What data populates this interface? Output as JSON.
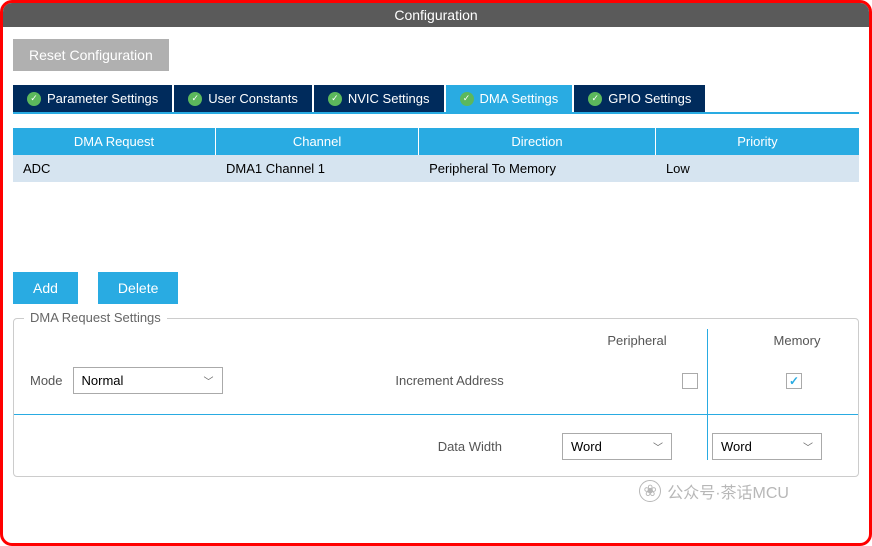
{
  "title": "Configuration",
  "reset_button": "Reset Configuration",
  "tabs": [
    {
      "label": "Parameter Settings",
      "active": false
    },
    {
      "label": "User Constants",
      "active": false
    },
    {
      "label": "NVIC Settings",
      "active": false
    },
    {
      "label": "DMA Settings",
      "active": true
    },
    {
      "label": "GPIO Settings",
      "active": false
    }
  ],
  "table": {
    "headers": [
      "DMA Request",
      "Channel",
      "Direction",
      "Priority"
    ],
    "rows": [
      {
        "request": "ADC",
        "channel": "DMA1 Channel 1",
        "direction": "Peripheral To Memory",
        "priority": "Low"
      }
    ]
  },
  "buttons": {
    "add": "Add",
    "delete": "Delete"
  },
  "settings": {
    "legend": "DMA Request Settings",
    "mode_label": "Mode",
    "mode_value": "Normal",
    "increment_label": "Increment Address",
    "col_peripheral": "Peripheral",
    "col_memory": "Memory",
    "peripheral_checked": false,
    "memory_checked": true,
    "data_width_label": "Data Width",
    "data_width_peripheral": "Word",
    "data_width_memory": "Word"
  },
  "watermark": "公众号·茶话MCU"
}
